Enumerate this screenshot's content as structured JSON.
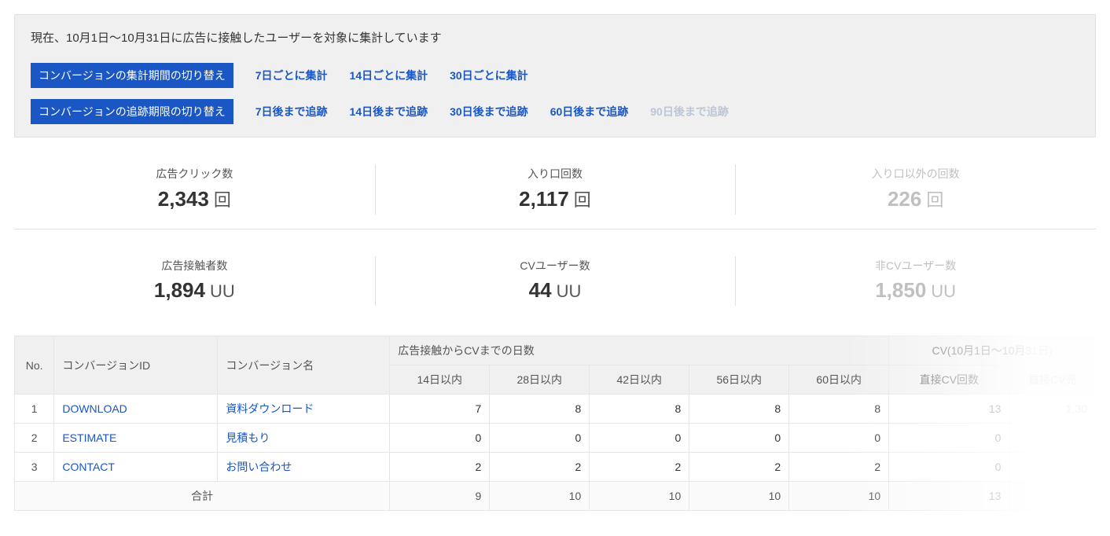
{
  "notice": "現在、10月1日～10月31日に広告に接触したユーザーを対象に集計しています",
  "filters": {
    "period": {
      "label": "コンバージョンの集計期間の切り替え",
      "options": [
        "7日ごとに集計",
        "14日ごとに集計",
        "30日ごとに集計"
      ]
    },
    "tracking": {
      "label": "コンバージョンの追跡期限の切り替え",
      "options": [
        "7日後まで追跡",
        "14日後まで追跡",
        "30日後まで追跡",
        "60日後まで追跡",
        "90日後まで追跡"
      ],
      "disabled_idx": 4
    }
  },
  "stats": {
    "row1": [
      {
        "label": "広告クリック数",
        "value": "2,343",
        "unit": "回",
        "faded": false
      },
      {
        "label": "入り口回数",
        "value": "2,117",
        "unit": "回",
        "faded": false
      },
      {
        "label": "入り口以外の回数",
        "value": "226",
        "unit": "回",
        "faded": true
      }
    ],
    "row2": [
      {
        "label": "広告接触者数",
        "value": "1,894",
        "unit": "UU",
        "faded": false
      },
      {
        "label": "CVユーザー数",
        "value": "44",
        "unit": "UU",
        "faded": false
      },
      {
        "label": "非CVユーザー数",
        "value": "1,850",
        "unit": "UU",
        "faded": true
      }
    ]
  },
  "table": {
    "header": {
      "no": "No.",
      "cv_id": "コンバージョンID",
      "cv_name": "コンバージョン名",
      "days_group": "広告接触からCVまでの日数",
      "days": [
        "14日以内",
        "28日以内",
        "42日以内",
        "56日以内",
        "60日以内"
      ],
      "cv_group": "CV(10月1日～10月31日)",
      "cv_cols": [
        "直接CV回数",
        "直接CV売"
      ]
    },
    "rows": [
      {
        "no": "1",
        "id": "DOWNLOAD",
        "name": "資料ダウンロード",
        "days": [
          "7",
          "8",
          "8",
          "8",
          "8"
        ],
        "cv": [
          "13",
          "1,30"
        ]
      },
      {
        "no": "2",
        "id": "ESTIMATE",
        "name": "見積もり",
        "days": [
          "0",
          "0",
          "0",
          "0",
          "0"
        ],
        "cv": [
          "0",
          ""
        ]
      },
      {
        "no": "3",
        "id": "CONTACT",
        "name": "お問い合わせ",
        "days": [
          "2",
          "2",
          "2",
          "2",
          "2"
        ],
        "cv": [
          "0",
          ""
        ]
      }
    ],
    "totals": {
      "label": "合計",
      "days": [
        "9",
        "10",
        "10",
        "10",
        "10"
      ],
      "cv": [
        "13",
        ""
      ]
    }
  }
}
